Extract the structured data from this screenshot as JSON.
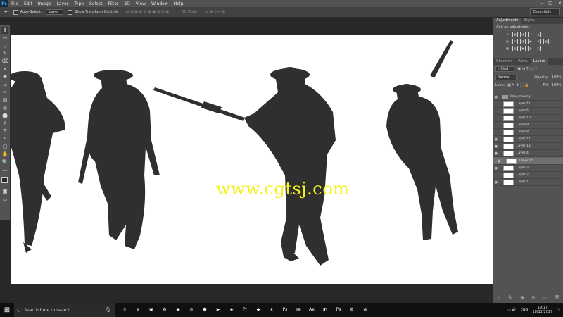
{
  "menubar": {
    "logo": "Ps",
    "items": [
      "File",
      "Edit",
      "Image",
      "Layer",
      "Type",
      "Select",
      "Filter",
      "3D",
      "View",
      "Window",
      "Help"
    ],
    "window_controls": [
      "–",
      "□",
      "✕"
    ]
  },
  "options": {
    "auto_select_label": "Auto-Select:",
    "auto_select_value": "Layer",
    "transform_label": "Show Transform Controls",
    "mode_label": "3D Mode:",
    "workspace": "Essentials"
  },
  "tools": [
    "✥",
    "▭",
    "◌",
    "✎",
    "⌫",
    "⌖",
    "✚",
    "⊿",
    "✑",
    "▤",
    "◍",
    "⬤",
    "✐",
    "T",
    "↖",
    "▢",
    "✋",
    "🔍",
    "…"
  ],
  "canvas": {
    "watermark": "www.cgtsj.com",
    "background": "#ffffff"
  },
  "panels": {
    "adjust_tabs": [
      "Adjustments",
      "Styles"
    ],
    "add_adjustment": "Add an adjustment",
    "adj_rows": [
      [
        "☀",
        "▦",
        "◑",
        "⊿",
        "▲"
      ],
      [
        "▤",
        "⚖",
        "◨",
        "◐",
        "⊕",
        "▦"
      ],
      [
        "▩",
        "▨",
        "▣",
        "▥",
        "▢"
      ]
    ],
    "layer_tabs": [
      "Channels",
      "Paths",
      "Layers"
    ],
    "kind_label": "Kind",
    "blend_mode": "Normal",
    "opacity_label": "Opacity:",
    "opacity_value": "100%",
    "lock_label": "Lock:",
    "fill_label": "Fill:",
    "fill_value": "100%",
    "layers": [
      {
        "name": "line_drawing",
        "type": "folder",
        "visible": true
      },
      {
        "name": "Layer 11",
        "visible": false
      },
      {
        "name": "Layer 6",
        "visible": false
      },
      {
        "name": "Layer 10",
        "visible": false
      },
      {
        "name": "Layer 9",
        "visible": false
      },
      {
        "name": "Layer 8",
        "visible": false
      },
      {
        "name": "Layer 14",
        "visible": true
      },
      {
        "name": "Layer 13",
        "visible": true
      },
      {
        "name": "Layer 4",
        "visible": true
      },
      {
        "name": "Layer 15",
        "visible": true,
        "selected": true
      },
      {
        "name": "Layer 3",
        "visible": true
      },
      {
        "name": "Layer 2",
        "visible": false
      },
      {
        "name": "Layer 1",
        "visible": true
      }
    ],
    "bottom_icons": [
      "∞",
      "fx",
      "◑",
      "⊕",
      "▭",
      "🗑"
    ]
  },
  "taskbar": {
    "search_placeholder": "Search here to search",
    "apps": [
      "▯",
      "e",
      "▣",
      "⚙",
      "◉",
      "⊙",
      "⬢",
      "▶",
      "◈",
      "Pr",
      "◆",
      "★",
      "Ps",
      "▤",
      "Ae",
      "◧",
      "Ps",
      "⚙",
      "◍"
    ],
    "lang": "ENG",
    "time": "19:17",
    "date": "18/11/2017"
  }
}
